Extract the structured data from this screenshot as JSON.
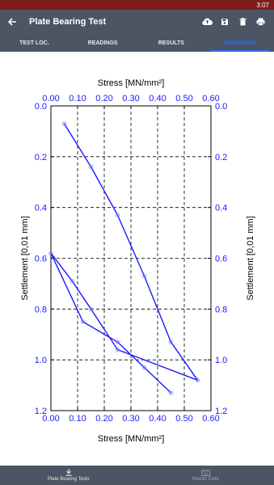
{
  "status": {
    "time": "3:07"
  },
  "app_bar": {
    "title": "Plate Bearing Test",
    "back_icon": "arrow-left-icon",
    "actions": [
      "cloud-upload-icon",
      "save-icon",
      "trash-icon",
      "print-icon"
    ]
  },
  "tabs": [
    {
      "label": "TEST LOC.",
      "active": false
    },
    {
      "label": "READINGS",
      "active": false
    },
    {
      "label": "RESULTS",
      "active": false
    },
    {
      "label": "DIAGRAMM",
      "active": true
    }
  ],
  "chart_data": {
    "type": "line",
    "xlabel": "Stress [MN/mm²]",
    "ylabel": "Settlement [0,01 mm]",
    "xlim": [
      0.0,
      0.6
    ],
    "ylim": [
      0.0,
      1.2
    ],
    "y_inverted": true,
    "x_ticks": [
      "0.00",
      "0.10",
      "0.20",
      "0.30",
      "0.40",
      "0.50",
      "0.60"
    ],
    "y_ticks": [
      "0.0",
      "0.2",
      "0.4",
      "0.6",
      "0.8",
      "1.0",
      "1.2"
    ],
    "grid": "dashed",
    "line_color": "#1a1aff",
    "tick_color": "#1a1aff",
    "series": [
      {
        "points": [
          [
            0.05,
            0.07
          ],
          [
            0.15,
            0.24
          ],
          [
            0.25,
            0.43
          ],
          [
            0.35,
            0.67
          ],
          [
            0.45,
            0.93
          ],
          [
            0.55,
            1.08
          ],
          [
            0.25,
            0.96
          ],
          [
            0.15,
            0.8
          ],
          [
            0.08,
            0.69
          ],
          [
            0.0,
            0.58
          ],
          [
            0.12,
            0.85
          ],
          [
            0.25,
            0.93
          ],
          [
            0.35,
            1.03
          ],
          [
            0.45,
            1.13
          ]
        ]
      }
    ]
  },
  "bottom_nav": [
    {
      "label": "Plate Bearing Tests",
      "icon": "download-icon",
      "active": true
    },
    {
      "label": "Master Data",
      "icon": "keyboard-icon",
      "active": false
    }
  ]
}
